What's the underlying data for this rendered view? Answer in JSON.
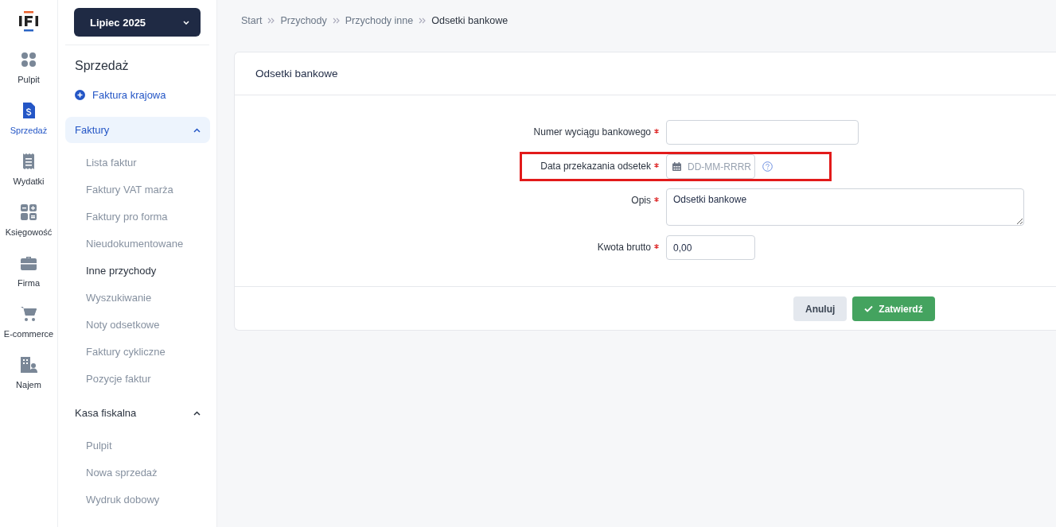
{
  "rail": {
    "items": [
      {
        "label": "Pulpit",
        "selected": false
      },
      {
        "label": "Sprzedaż",
        "selected": true
      },
      {
        "label": "Wydatki",
        "selected": false
      },
      {
        "label": "Księgowość",
        "selected": false
      },
      {
        "label": "Firma",
        "selected": false
      },
      {
        "label": "E-commerce",
        "selected": false
      },
      {
        "label": "Najem",
        "selected": false
      }
    ]
  },
  "period": {
    "label": "Lipiec 2025"
  },
  "menu": {
    "title": "Sprzedaż",
    "action": "Faktura krajowa",
    "groups": [
      {
        "label": "Faktury",
        "expanded": true,
        "selected": true,
        "items": [
          {
            "label": "Lista faktur",
            "selected": false
          },
          {
            "label": "Faktury VAT marża",
            "selected": false
          },
          {
            "label": "Faktury pro forma",
            "selected": false
          },
          {
            "label": "Nieudokumentowane",
            "selected": false
          },
          {
            "label": "Inne przychody",
            "selected": true
          },
          {
            "label": "Wyszukiwanie",
            "selected": false
          },
          {
            "label": "Noty odsetkowe",
            "selected": false
          },
          {
            "label": "Faktury cykliczne",
            "selected": false
          },
          {
            "label": "Pozycje faktur",
            "selected": false
          }
        ]
      },
      {
        "label": "Kasa fiskalna",
        "expanded": true,
        "selected": false,
        "items": [
          {
            "label": "Pulpit",
            "selected": false
          },
          {
            "label": "Nowa sprzedaż",
            "selected": false
          },
          {
            "label": "Wydruk dobowy",
            "selected": false
          }
        ]
      }
    ]
  },
  "breadcrumb": [
    "Start",
    "Przychody",
    "Przychody inne",
    "Odsetki bankowe"
  ],
  "form": {
    "title": "Odsetki bankowe",
    "fields": [
      {
        "kind": "text",
        "label": "Numer wyciągu bankowego",
        "required": true,
        "highlighted": false
      },
      {
        "kind": "date",
        "label": "Data przekazania odsetek",
        "required": true,
        "placeholder": "DD-MM-RRRR",
        "highlighted": true
      },
      {
        "kind": "textarea",
        "label": "Opis",
        "required": true,
        "value": "Odsetki bankowe",
        "highlighted": false
      },
      {
        "kind": "number",
        "label": "Kwota brutto",
        "required": true,
        "value": "0,00",
        "highlighted": false
      }
    ],
    "buttons": [
      {
        "kind": "secondary",
        "label": "Anuluj"
      },
      {
        "kind": "primary",
        "label": "Zatwierdź"
      }
    ]
  }
}
